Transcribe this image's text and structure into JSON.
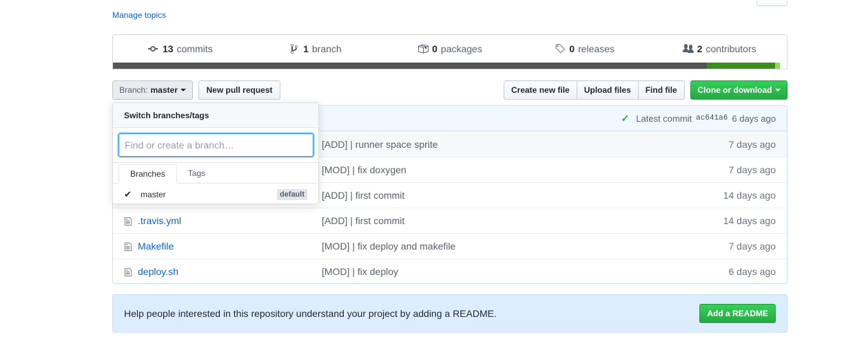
{
  "topics": {
    "manage_label": "Manage topics"
  },
  "summary": {
    "commits": {
      "count": "13",
      "label": "commits",
      "icon": "commit-icon"
    },
    "branches": {
      "count": "1",
      "label": "branch",
      "icon": "branch-icon"
    },
    "packages": {
      "count": "0",
      "label": "packages",
      "icon": "package-icon"
    },
    "releases": {
      "count": "0",
      "label": "releases",
      "icon": "tag-icon"
    },
    "contributors": {
      "count": "2",
      "label": "contributors",
      "icon": "people-icon"
    },
    "language_bar": [
      {
        "color": "#555555",
        "percent": 88.1
      },
      {
        "color": "#3c8c1e",
        "percent": 10.2
      },
      {
        "color": "#89e051",
        "percent": 0.7
      },
      {
        "color": "#ffffff",
        "percent": 1.0
      }
    ]
  },
  "toolbar": {
    "branch_prefix": "Branch:",
    "branch_name": "master",
    "new_pr_label": "New pull request",
    "create_file_label": "Create new file",
    "upload_label": "Upload files",
    "find_label": "Find file",
    "clone_label": "Clone or download"
  },
  "dropdown": {
    "title": "Switch branches/tags",
    "filter_placeholder": "Find or create a branch…",
    "tabs": [
      "Branches",
      "Tags"
    ],
    "items": [
      {
        "name": "master",
        "selected": true,
        "badge": "default"
      }
    ]
  },
  "latest_commit": {
    "label": "Latest commit",
    "sha": "ac641a6",
    "age": "6 days ago"
  },
  "files": [
    {
      "name": "",
      "message": "[ADD] | runner space sprite",
      "age": "7 days ago"
    },
    {
      "name": "",
      "message": "[MOD] | fix doxygen",
      "age": "7 days ago"
    },
    {
      "name": "",
      "message": "[ADD] | first commit",
      "age": "14 days ago"
    },
    {
      "name": ".travis.yml",
      "message": "[ADD] | first commit",
      "age": "14 days ago"
    },
    {
      "name": "Makefile",
      "message": "[MOD] | fix deploy and makefile",
      "age": "7 days ago"
    },
    {
      "name": "deploy.sh",
      "message": "[MOD] | fix deploy",
      "age": "6 days ago"
    }
  ],
  "readme_banner": {
    "text": "Help people interested in this repository understand your project by adding a README.",
    "button_label": "Add a README"
  }
}
